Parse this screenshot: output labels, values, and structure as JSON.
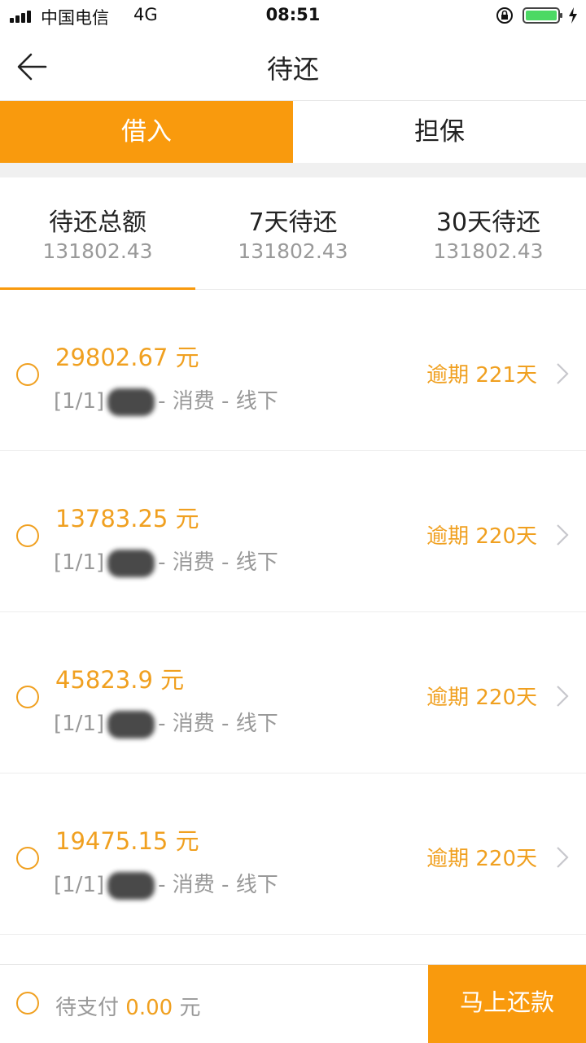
{
  "status_bar": {
    "carrier": "中国电信",
    "network": "4G",
    "time": "08:51",
    "battery_level": 1.0,
    "icons": [
      "signal-icon",
      "orientation-lock-icon",
      "battery-icon",
      "charging-icon"
    ]
  },
  "nav": {
    "title": "待还",
    "back_icon": "back-arrow-icon"
  },
  "segments": [
    {
      "label": "借入",
      "active": true
    },
    {
      "label": "担保",
      "active": false
    }
  ],
  "summary": [
    {
      "label": "待还总额",
      "value": "131802.43",
      "selected": true
    },
    {
      "label": "7天待还",
      "value": "131802.43",
      "selected": false
    },
    {
      "label": "30天待还",
      "value": "131802.43",
      "selected": false
    }
  ],
  "loans": [
    {
      "amount": "29802.67 元",
      "index": "[1/1]",
      "name_masked": "杨康",
      "suffix": "- 消费 - 线下",
      "overdue": "逾期 221天"
    },
    {
      "amount": "13783.25 元",
      "index": "[1/1]",
      "name_masked": "曾毅",
      "suffix": "- 消费 - 线下",
      "overdue": "逾期 220天"
    },
    {
      "amount": "45823.9 元",
      "index": "[1/1]",
      "name_masked": "马顺",
      "suffix": "- 消费 - 线下",
      "overdue": "逾期 220天"
    },
    {
      "amount": "19475.15 元",
      "index": "[1/1]",
      "name_masked": "胡涛",
      "suffix": "- 消费 - 线下",
      "overdue": "逾期 220天"
    }
  ],
  "bottom": {
    "pay_prefix": "待支付",
    "pay_amount": "0.00",
    "pay_unit": "元",
    "button_label": "马上还款"
  },
  "colors": {
    "accent": "#f99a0d",
    "amount_text": "#f0a020",
    "muted_text": "#999999",
    "divider": "#ececec"
  }
}
